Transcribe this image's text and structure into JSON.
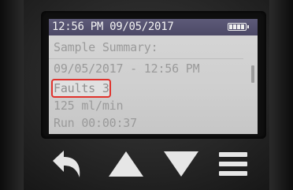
{
  "status_bar": {
    "datetime": "12:56 PM 09/05/2017",
    "battery_icon": "battery-icon"
  },
  "screen": {
    "title": "Sample Summary:",
    "sample_time": "09/05/2017 - 12:56 PM",
    "faults": "Faults 3",
    "flow_rate": "125 ml/min",
    "run_time": "Run 00:00:37"
  },
  "controls": {
    "back_icon": "back-arrow-icon",
    "up_icon": "up-arrow-icon",
    "down_icon": "down-arrow-icon",
    "menu_icon": "menu-icon",
    "accent_color": "#e6e6e6",
    "highlight_color": "#e0322c"
  }
}
